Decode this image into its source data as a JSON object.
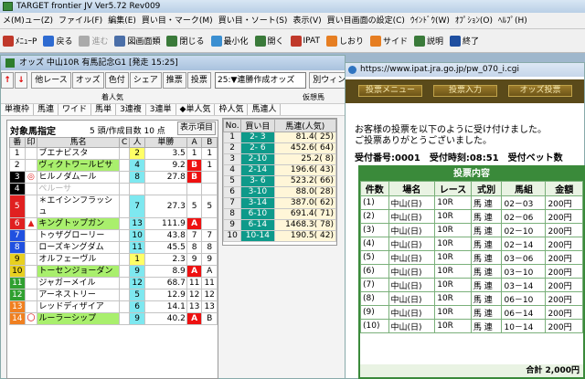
{
  "app": {
    "title": "TARGET frontier JV  Ver5.72  Rev009"
  },
  "menu": [
    "メ(M)ュー(Z)",
    "ファイル(F)",
    "編集(E)",
    "買い目・マーク(M)",
    "買い目・ソート(S)",
    "表示(V)",
    "買い目画面の設定(C)",
    "ｳｲﾝﾄﾞｳ(W)",
    "ｵﾌﾟｼｮﾝ(O)",
    "ﾍﾙﾌﾟ(H)"
  ],
  "toolbar": [
    {
      "label": "ﾒﾆｭｰP",
      "icon": "menu-icon",
      "color": "#c0392b",
      "disabled": false
    },
    {
      "label": "戻る",
      "icon": "back-arrow-icon",
      "color": "#2e6bd1",
      "disabled": false
    },
    {
      "label": "進む",
      "icon": "forward-arrow-icon",
      "color": "#aaaaaa",
      "disabled": true
    },
    {
      "label": "図画面類",
      "icon": "screen-icon",
      "color": "#4b6fa8",
      "disabled": false
    },
    {
      "label": "閉じる",
      "icon": "close-window-icon",
      "color": "#3a7a3a",
      "disabled": false
    },
    {
      "label": "最小化",
      "icon": "minimize-icon",
      "color": "#3b8fd1",
      "disabled": false
    },
    {
      "label": "開く",
      "icon": "open-icon",
      "color": "#3a7a3a",
      "disabled": false
    },
    {
      "label": "IPAT",
      "icon": "ipat-icon",
      "color": "#c0392b",
      "disabled": false
    },
    {
      "label": "しおり",
      "icon": "bookmark-icon",
      "color": "#e67e22",
      "disabled": false
    },
    {
      "label": "サイド",
      "icon": "side-icon",
      "color": "#e67e22",
      "disabled": false
    },
    {
      "label": "説明",
      "icon": "help-icon",
      "color": "#3a7a3a",
      "disabled": false
    },
    {
      "label": "終了",
      "icon": "exit-icon",
      "color": "#1f4fa0",
      "disabled": false
    }
  ],
  "odds_window": {
    "title": "オッズ 中山10R 有馬記念G1 [発走 15:25]",
    "buttons": [
      "他レース",
      "オッズ",
      "色付",
      "シェア",
      "推票",
      "投票"
    ],
    "select_value": "25:▼連勝作成オッズ",
    "right_buttons": [
      "別ウィンドウ"
    ],
    "labels": {
      "left": "着人気",
      "right": "仮想馬"
    },
    "bet_types": [
      "単複枠",
      "馬連",
      "ワイド",
      "馬単",
      "3連複",
      "3連単",
      "◆単人気",
      "枠人気",
      "馬連人"
    ],
    "target": {
      "label": "対象馬指定",
      "count_text": "5 頭/作成目数 10 点",
      "button": "表示項目"
    },
    "horse_headers": [
      "番",
      "印",
      "馬名",
      "C",
      "人",
      "単勝",
      "A",
      "B"
    ],
    "horses": [
      {
        "no": "1",
        "mark": "",
        "name": "ブエナビスタ",
        "c": "",
        "pop": "2",
        "odds": "3.5",
        "a": "1",
        "b": "1",
        "hl": false,
        "gray": false,
        "pop_hi": true,
        "b_red": false
      },
      {
        "no": "2",
        "mark": "",
        "name": "ヴィクトワールピサ",
        "c": "",
        "pop": "4",
        "odds": "9.2",
        "a": "B",
        "b": "1",
        "hl": true,
        "gray": false,
        "pop_hi": false,
        "b_red": true
      },
      {
        "no": "3",
        "mark": "◎",
        "name": "ヒルノダムール",
        "c": "",
        "pop": "8",
        "odds": "27.8",
        "a": "B",
        "b": "",
        "hl": false,
        "gray": false,
        "pop_hi": false,
        "b_red": true
      },
      {
        "no": "4",
        "mark": "",
        "name": "ペルーサ",
        "c": "",
        "pop": "",
        "odds": "",
        "a": "",
        "b": "",
        "hl": false,
        "gray": true,
        "pop_hi": false,
        "b_red": false
      },
      {
        "no": "5",
        "mark": "",
        "name": "＊エイシンフラッシュ",
        "c": "",
        "pop": "7",
        "odds": "27.3",
        "a": "5",
        "b": "5",
        "hl": false,
        "gray": false,
        "pop_hi": false,
        "b_red": false
      },
      {
        "no": "6",
        "mark": "▲",
        "name": "キングトップガン",
        "c": "",
        "pop": "13",
        "odds": "111.9",
        "a": "A",
        "b": "",
        "hl": true,
        "gray": false,
        "pop_hi": false,
        "b_red": true
      },
      {
        "no": "7",
        "mark": "",
        "name": "トゥザグローリー",
        "c": "",
        "pop": "10",
        "odds": "43.8",
        "a": "7",
        "b": "7",
        "hl": false,
        "gray": false,
        "pop_hi": false,
        "b_red": false
      },
      {
        "no": "8",
        "mark": "",
        "name": "ローズキングダム",
        "c": "",
        "pop": "11",
        "odds": "45.5",
        "a": "8",
        "b": "8",
        "hl": false,
        "gray": false,
        "pop_hi": false,
        "b_red": false
      },
      {
        "no": "9",
        "mark": "",
        "name": "オルフェーヴル",
        "c": "",
        "pop": "1",
        "odds": "2.3",
        "a": "9",
        "b": "9",
        "hl": false,
        "gray": false,
        "pop_hi": true,
        "b_red": false
      },
      {
        "no": "10",
        "mark": "",
        "name": "トーセンジョーダン",
        "c": "",
        "pop": "9",
        "odds": "8.9",
        "a": "A",
        "b": "A",
        "hl": true,
        "gray": false,
        "pop_hi": false,
        "b_red": true
      },
      {
        "no": "11",
        "mark": "",
        "name": "ジャガーメイル",
        "c": "",
        "pop": "12",
        "odds": "68.7",
        "a": "11",
        "b": "11",
        "hl": false,
        "gray": false,
        "pop_hi": false,
        "b_red": false
      },
      {
        "no": "12",
        "mark": "",
        "name": "アーネストリー",
        "c": "",
        "pop": "5",
        "odds": "12.9",
        "a": "12",
        "b": "12",
        "hl": false,
        "gray": false,
        "pop_hi": false,
        "b_red": false
      },
      {
        "no": "13",
        "mark": "",
        "name": "レッドディザイア",
        "c": "",
        "pop": "6",
        "odds": "14.1",
        "a": "13",
        "b": "13",
        "hl": false,
        "gray": false,
        "pop_hi": false,
        "b_red": false
      },
      {
        "no": "14",
        "mark": "〇",
        "name": "ルーラーシップ",
        "c": "",
        "pop": "9",
        "odds": "40.2",
        "a": "A",
        "b": "B",
        "hl": true,
        "gray": false,
        "pop_hi": false,
        "b_red": true
      }
    ],
    "combo_headers": [
      "No.",
      "買い目",
      "馬連(人気)"
    ],
    "combos": [
      {
        "no": "1",
        "combo": "2- 3",
        "odds": "81.4( 25)"
      },
      {
        "no": "2",
        "combo": "2- 6",
        "odds": "452.6( 64)"
      },
      {
        "no": "3",
        "combo": "2-10",
        "odds": "25.2(  8)"
      },
      {
        "no": "4",
        "combo": "2-14",
        "odds": "196.6( 43)"
      },
      {
        "no": "5",
        "combo": "3- 6",
        "odds": "523.2( 66)"
      },
      {
        "no": "6",
        "combo": "3-10",
        "odds": "88.0( 28)"
      },
      {
        "no": "7",
        "combo": "3-14",
        "odds": "387.0( 62)"
      },
      {
        "no": "8",
        "combo": "6-10",
        "odds": "691.4( 71)"
      },
      {
        "no": "9",
        "combo": "6-14",
        "odds": "1468.3( 78)"
      },
      {
        "no": "10",
        "combo": "10-14",
        "odds": "190.5( 42)"
      }
    ]
  },
  "browser": {
    "url": "https://www.ipat.jra.go.jp/pw_070_i.cgi",
    "nav_buttons": [
      "投票メニュー",
      "投票入力",
      "オッズ投票"
    ],
    "message_line1": "お客様の投票を以下のように受け付けました。",
    "message_line2": "ご投票ありがとうございました。",
    "accept_line": "受付番号:0001　受付時刻:08:51　受付ベット数",
    "bet_header": "投票内容",
    "bet_columns": [
      "件数",
      "場名",
      "レース",
      "式別",
      "馬組",
      "金額"
    ],
    "bets": [
      {
        "n": "(1)",
        "place": "中山(日)",
        "race": "10R",
        "type": "馬 連",
        "combo": "02－03",
        "amount": "200円"
      },
      {
        "n": "(2)",
        "place": "中山(日)",
        "race": "10R",
        "type": "馬 連",
        "combo": "02－06",
        "amount": "200円"
      },
      {
        "n": "(3)",
        "place": "中山(日)",
        "race": "10R",
        "type": "馬 連",
        "combo": "02－10",
        "amount": "200円"
      },
      {
        "n": "(4)",
        "place": "中山(日)",
        "race": "10R",
        "type": "馬 連",
        "combo": "02－14",
        "amount": "200円"
      },
      {
        "n": "(5)",
        "place": "中山(日)",
        "race": "10R",
        "type": "馬 連",
        "combo": "03－06",
        "amount": "200円"
      },
      {
        "n": "(6)",
        "place": "中山(日)",
        "race": "10R",
        "type": "馬 連",
        "combo": "03－10",
        "amount": "200円"
      },
      {
        "n": "(7)",
        "place": "中山(日)",
        "race": "10R",
        "type": "馬 連",
        "combo": "03－14",
        "amount": "200円"
      },
      {
        "n": "(8)",
        "place": "中山(日)",
        "race": "10R",
        "type": "馬 連",
        "combo": "06－10",
        "amount": "200円"
      },
      {
        "n": "(9)",
        "place": "中山(日)",
        "race": "10R",
        "type": "馬 連",
        "combo": "06－14",
        "amount": "200円"
      },
      {
        "n": "(10)",
        "place": "中山(日)",
        "race": "10R",
        "type": "馬 連",
        "combo": "10－14",
        "amount": "200円"
      }
    ],
    "total": "合計 2,000円"
  },
  "frame_colors": [
    "#ffffff",
    "#000000",
    "#e02020",
    "#2050e0",
    "#e8d020",
    "#30a030",
    "#f08020",
    "#f060b0"
  ]
}
